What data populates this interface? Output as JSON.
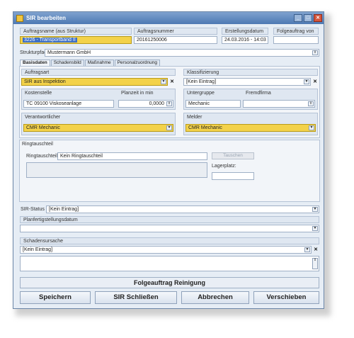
{
  "window": {
    "title": "SIR bearbeiten",
    "minimize": "_",
    "maximize": "□",
    "close": "✕"
  },
  "header": {
    "auftragsname_label": "Auftragsname (aus Struktur)",
    "auftragsname_value": "3226 - Transportband II",
    "auftragsnummer_label": "Auftragsnummer",
    "auftragsnummer_value": "20161250006",
    "erstellungsdatum_label": "Erstellungsdatum",
    "erstellungsdatum_value": "24.03.2016 - 14:03",
    "folgeauftrag_label": "Folgeauftrag von",
    "folgeauftrag_value": ""
  },
  "strukturpfad": {
    "label": "Strukturpfad",
    "value": "Mustermann GmbH"
  },
  "tabs": [
    "Basisdaten",
    "Schadensbild",
    "Maßnahme",
    "Personalzuordnung"
  ],
  "basisdaten": {
    "auftragsart_label": "Auftragsart",
    "auftragsart_value": "SIR aus Inspektion",
    "klassifizierung_label": "Klassifizierung",
    "klassifizierung_value": "[Kein Eintrag]",
    "kostenstelle_label": "Kostenstelle",
    "kostenstelle_value": "TC 09100 Viskoseanlage",
    "planzeit_label": "Planzeit in min",
    "planzeit_value": "0,0000",
    "untergruppe_label": "Untergruppe",
    "untergruppe_value": "Mechanic",
    "fremdfirma_label": "Fremdfirma",
    "fremdfirma_value": "",
    "verantwortlicher_label": "Verantwortlicher",
    "verantwortlicher_value": "CMR Mechanic",
    "melder_label": "Melder",
    "melder_value": "CMR Mechanic"
  },
  "ringtauschteil": {
    "section_label": "Ringtauschteil",
    "field_label": "Ringtauschteil:",
    "field_value": "Kein Ringtauschteil",
    "tauschen_label": "Tauschen",
    "lagerplatz_label": "Lagerplatz:",
    "lagerplatz_value": ""
  },
  "sir_status": {
    "label": "SIR-Status",
    "value": "[Kein Eintrag]"
  },
  "planfertigstellung": {
    "label": "Planfertigstellungsdatum",
    "value": ""
  },
  "schadensursache": {
    "label": "Schadensursache",
    "value": "[Kein Eintrag]"
  },
  "buttons": {
    "folgeauftrag": "Folgeauftrag Reinigung",
    "speichern": "Speichern",
    "schliessen": "SIR Schließen",
    "abbrechen": "Abbrechen",
    "verschieben": "Verschieben"
  },
  "colors": {
    "highlight_yellow": "#f3d24a",
    "title_blue": "#4d79b3",
    "selection_blue": "#3d6fc4"
  }
}
